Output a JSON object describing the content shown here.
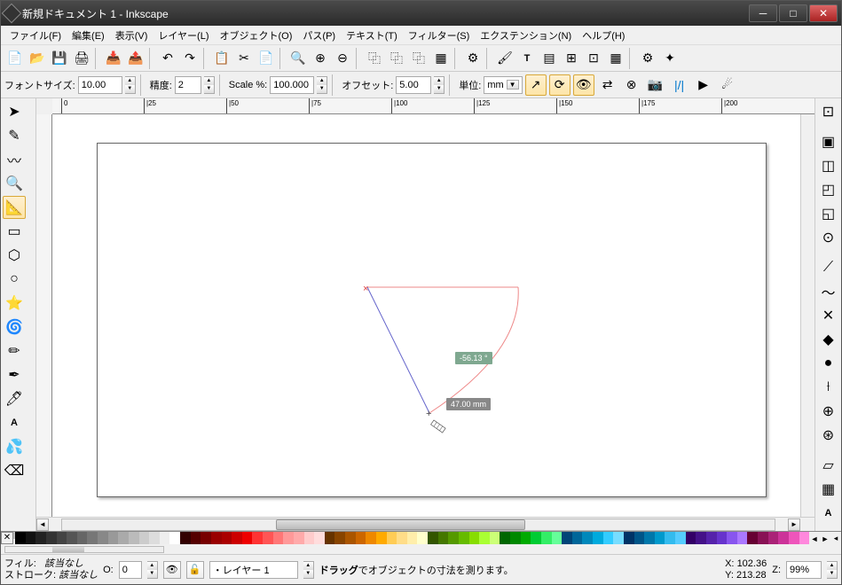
{
  "title": "新規ドキュメント 1 - Inkscape",
  "menu": [
    "ファイル(F)",
    "編集(E)",
    "表示(V)",
    "レイヤー(L)",
    "オブジェクト(O)",
    "パス(P)",
    "テキスト(T)",
    "フィルター(S)",
    "エクステンション(N)",
    "ヘルプ(H)"
  ],
  "opts": {
    "fontsize_lbl": "フォントサイズ:",
    "fontsize": "10.00",
    "precision_lbl": "精度:",
    "precision": "2",
    "scale_lbl": "Scale %:",
    "scale": "100.000",
    "offset_lbl": "オフセット:",
    "offset": "5.00",
    "unit_lbl": "単位:",
    "unit": "mm"
  },
  "ruler_ticks": [
    "0",
    "|25",
    "|50",
    "|75",
    "|100",
    "|125",
    "|150",
    "|175",
    "|200"
  ],
  "measure": {
    "angle": "-56.13 °",
    "distance": "47.00 mm"
  },
  "status": {
    "fill_lbl": "フィル:",
    "fill_val": "該当なし",
    "stroke_lbl": "ストローク:",
    "stroke_val": "該当なし",
    "o_lbl": "O:",
    "o_val": "0",
    "layer": "・レイヤー 1",
    "hint_bold": "ドラッグ",
    "hint_rest": "でオブジェクトの寸法を測ります。",
    "x_lbl": "X:",
    "x": "102.36",
    "y_lbl": "Y:",
    "y": "213.28",
    "z_lbl": "Z:",
    "zoom": "99%"
  },
  "palette": [
    "#000",
    "#111",
    "#222",
    "#333",
    "#444",
    "#555",
    "#666",
    "#777",
    "#888",
    "#999",
    "#aaa",
    "#bbb",
    "#ccc",
    "#ddd",
    "#eee",
    "#fff",
    "#300",
    "#500",
    "#700",
    "#900",
    "#a00",
    "#c00",
    "#e00",
    "#f33",
    "#f55",
    "#f77",
    "#f99",
    "#faa",
    "#fcc",
    "#fdd",
    "#630",
    "#840",
    "#a50",
    "#c60",
    "#e80",
    "#fa0",
    "#fc5",
    "#fd8",
    "#fea",
    "#ffc",
    "#350",
    "#470",
    "#590",
    "#6b0",
    "#8d0",
    "#af3",
    "#cf7",
    "#060",
    "#080",
    "#0a0",
    "#0c3",
    "#3e6",
    "#6f9",
    "#047",
    "#069",
    "#08b",
    "#0ad",
    "#3cf",
    "#7df",
    "#036",
    "#058",
    "#07a",
    "#09c",
    "#3be",
    "#5cf",
    "#306",
    "#418",
    "#52a",
    "#63c",
    "#85e",
    "#a7f",
    "#603",
    "#815",
    "#a27",
    "#c39",
    "#e5b",
    "#f8d"
  ]
}
